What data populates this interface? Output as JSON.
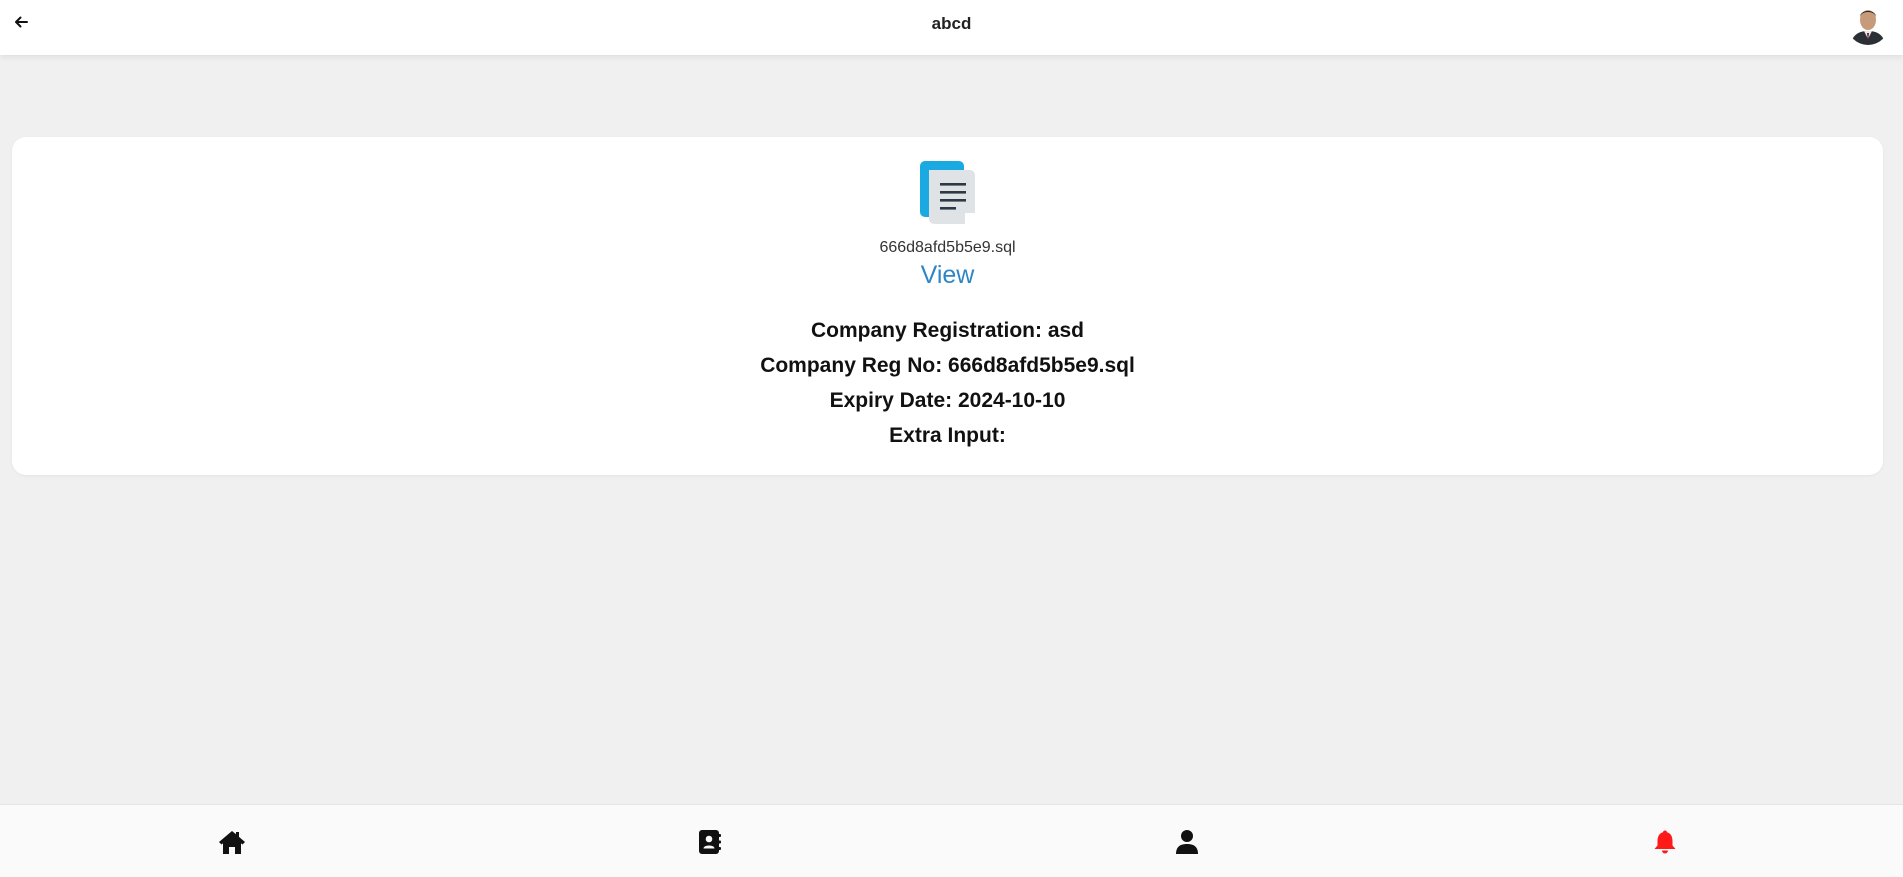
{
  "header": {
    "title": "abcd",
    "back_icon": "arrow-left-icon",
    "avatar": "user-avatar"
  },
  "document": {
    "icon": "document-icon",
    "file_name": "666d8afd5b5e9.sql",
    "view_label": "View",
    "details": [
      "Company Registration: asd",
      "Company Reg No: 666d8afd5b5e9.sql",
      "Expiry Date: 2024-10-10",
      "Extra Input:"
    ]
  },
  "bottom_nav": {
    "items": [
      {
        "icon": "home-icon"
      },
      {
        "icon": "contacts-book-icon"
      },
      {
        "icon": "user-icon"
      },
      {
        "icon": "bell-icon",
        "color": "#ff1a1a"
      }
    ]
  },
  "colors": {
    "accent_link": "#2f86c6",
    "background": "#f0f0f0",
    "notification": "#ff1a1a"
  }
}
